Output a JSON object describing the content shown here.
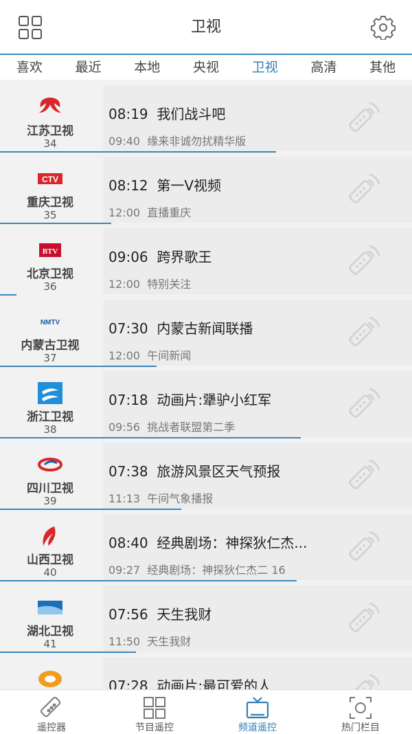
{
  "header": {
    "title": "卫视",
    "left_icon": "grid-icon",
    "right_icon": "gear-icon"
  },
  "tabs": [
    {
      "label": "喜欢"
    },
    {
      "label": "最近"
    },
    {
      "label": "本地"
    },
    {
      "label": "央视"
    },
    {
      "label": "卫视",
      "active": true
    },
    {
      "label": "高清"
    },
    {
      "label": "其他"
    }
  ],
  "channels": [
    {
      "name": "江苏卫视",
      "number": "34",
      "now_time": "08:19",
      "now_title": "我们战斗吧",
      "next_time": "09:40",
      "next_title": "缘来非诚勿扰精华版",
      "logo": "jiangsu-logo-icon",
      "progress": 0.67
    },
    {
      "name": "重庆卫视",
      "number": "35",
      "now_time": "08:12",
      "now_title": "第一V视频",
      "next_time": "12:00",
      "next_title": "直播重庆",
      "logo": "ctv-logo-icon",
      "logo_text": "CTV",
      "progress": 0.27
    },
    {
      "name": "北京卫视",
      "number": "36",
      "now_time": "09:06",
      "now_title": "跨界歌王",
      "next_time": "12:00",
      "next_title": "特别关注",
      "logo": "btv-logo-icon",
      "logo_text": "BTV",
      "progress": 0.04
    },
    {
      "name": "内蒙古卫视",
      "number": "37",
      "now_time": "07:30",
      "now_title": "内蒙古新闻联播",
      "next_time": "12:00",
      "next_title": "午间新闻",
      "logo": "nmtv-logo-icon",
      "logo_text": "NMTV",
      "progress": 0.38
    },
    {
      "name": "浙江卫视",
      "number": "38",
      "now_time": "07:18",
      "now_title": "动画片:犟驴小红军",
      "next_time": "09:56",
      "next_title": "挑战者联盟第二季",
      "logo": "zhejiang-logo-icon",
      "progress": 0.73
    },
    {
      "name": "四川卫视",
      "number": "39",
      "now_time": "07:38",
      "now_title": "旅游风景区天气预报",
      "next_time": "11:13",
      "next_title": "午间气象播报",
      "logo": "sichuan-logo-icon",
      "progress": 0.44
    },
    {
      "name": "山西卫视",
      "number": "40",
      "now_time": "08:40",
      "now_title": "经典剧场：神探狄仁杰...",
      "next_time": "09:27",
      "next_title": "经典剧场：神探狄仁杰二 16",
      "logo": "shanxi-logo-icon",
      "progress": 0.72
    },
    {
      "name": "湖北卫视",
      "number": "41",
      "now_time": "07:56",
      "now_title": "天生我财",
      "next_time": "11:50",
      "next_title": "天生我财",
      "logo": "hubei-logo-icon",
      "progress": 0.33
    },
    {
      "name": "",
      "number": "",
      "now_time": "07:28",
      "now_title": "动画片:最可爱的人",
      "next_time": "",
      "next_title": "",
      "logo": "hunan-logo-icon",
      "progress": 0
    }
  ],
  "bottom_nav": [
    {
      "label": "遥控器",
      "icon": "remote-control-icon"
    },
    {
      "label": "节目遥控",
      "icon": "program-grid-icon"
    },
    {
      "label": "频道遥控",
      "icon": "tv-icon",
      "active": true
    },
    {
      "label": "热门栏目",
      "icon": "hot-column-icon"
    }
  ],
  "colors": {
    "accent": "#2f7fb5",
    "header_bg": "#ffffff",
    "list_bg": "#ececec"
  }
}
